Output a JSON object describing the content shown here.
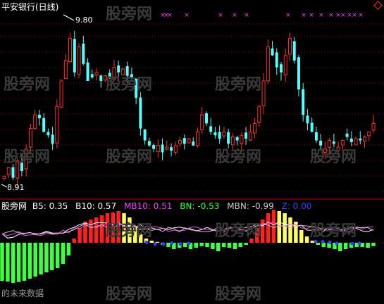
{
  "main_title": "平安银行(日线)",
  "high_label": "9.80",
  "low_label": "8.91",
  "watermark_text": "股旁网",
  "footer_text": "的未来数据",
  "indicator": {
    "name": "股旁网",
    "items": [
      {
        "label": "B5: 0.35",
        "color": "#ffffff"
      },
      {
        "label": "B10: 0.57",
        "color": "#ffffff"
      },
      {
        "label": "MB10: 0.51",
        "color": "#ff40ff"
      },
      {
        "label": "BN: -0.53",
        "color": "#40ff40"
      },
      {
        "label": "MBN: -0.99",
        "color": "#c8c8c8"
      },
      {
        "label": "Z: 0.00",
        "color": "#4040ff"
      }
    ]
  },
  "colors": {
    "up": "#ff3030",
    "down": "#54ffff",
    "grid": "#a00000",
    "red_bar": "#ff2020",
    "yellow_bar": "#ffff60",
    "green_bar": "#40ff40",
    "blue_dot": "#3040ff",
    "magenta_mark": "#ff40ff"
  },
  "chart_data": {
    "type": "candlestick",
    "ylim": [
      8.85,
      9.86
    ],
    "high": 9.8,
    "low": 8.91,
    "prices": [
      8.94,
      8.99,
      8.93,
      9.03,
      8.97,
      9.1,
      9.22,
      9.3,
      9.28,
      9.2,
      9.18,
      9.13,
      9.35,
      9.5,
      9.62,
      9.75,
      9.55,
      9.7,
      9.6,
      9.5,
      9.52,
      9.55,
      9.5,
      9.53,
      9.52,
      9.58,
      9.55,
      9.57,
      9.53,
      9.52,
      9.4,
      9.22,
      9.15,
      9.12,
      9.1,
      9.12,
      9.08,
      9.11,
      9.09,
      9.12,
      9.15,
      9.13,
      9.16,
      9.12,
      9.2,
      9.3,
      9.25,
      9.2,
      9.18,
      9.16,
      9.2,
      9.13,
      9.17,
      9.15,
      9.18,
      9.16,
      9.2,
      9.25,
      9.35,
      9.5,
      9.7,
      9.65,
      9.58,
      9.55,
      9.65,
      9.75,
      9.62,
      9.45,
      9.3,
      9.25,
      9.2,
      9.15,
      9.12,
      9.1,
      9.15,
      9.13,
      9.11,
      9.15,
      9.17,
      9.14,
      9.16,
      9.15,
      9.17,
      9.2,
      9.25
    ],
    "indicator_histogram": [
      -0.9,
      -0.92,
      -0.95,
      -0.93,
      -0.9,
      -0.85,
      -0.8,
      -0.75,
      -0.7,
      -0.65,
      -0.6,
      -0.5,
      -0.3,
      0.1,
      0.35,
      0.5,
      0.55,
      0.6,
      0.65,
      0.7,
      0.72,
      0.75,
      0.7,
      0.6,
      0.4,
      0.2,
      0.1,
      0.05,
      0.02,
      -0.05,
      -0.1,
      -0.15,
      -0.12,
      -0.1,
      -0.15,
      -0.12,
      -0.08,
      -0.1,
      -0.15,
      -0.2,
      -0.1,
      -0.12,
      -0.15,
      -0.1,
      -0.05,
      0.1,
      0.35,
      0.55,
      0.7,
      0.78,
      0.75,
      0.7,
      0.6,
      0.5,
      0.3,
      0.15,
      0.05,
      -0.05,
      -0.1,
      -0.12,
      -0.15,
      -0.2,
      -0.15,
      -0.12,
      -0.1,
      -0.1,
      -0.12,
      -0.08
    ]
  }
}
